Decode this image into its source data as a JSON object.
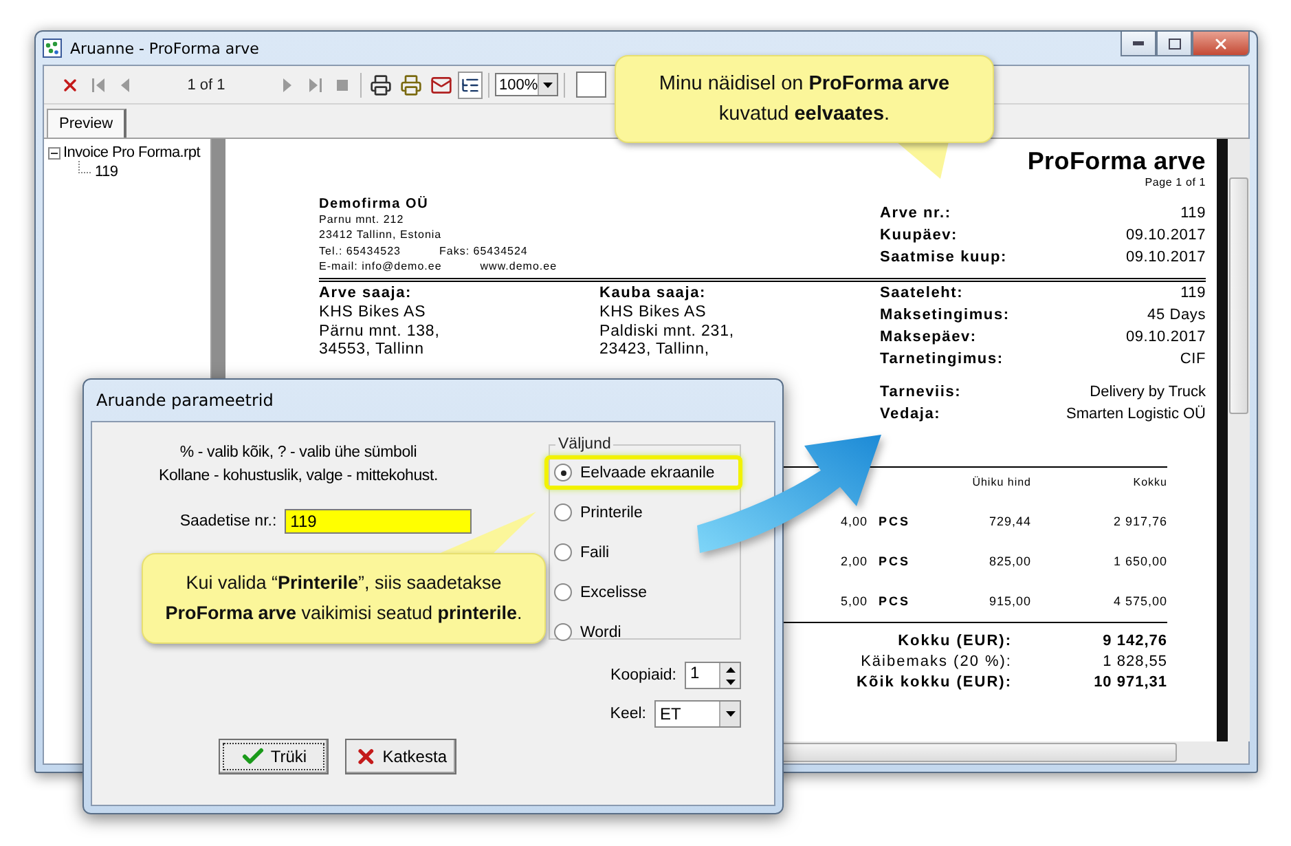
{
  "window": {
    "title": "Aruanne - ProForma arve",
    "page_indicator": "1 of 1",
    "zoom": "100%"
  },
  "tabs": [
    {
      "label": "Preview",
      "selected": true
    }
  ],
  "tree": [
    {
      "label": "Invoice Pro Forma.rpt",
      "expanded": true,
      "children": [
        {
          "label": "119"
        }
      ]
    }
  ],
  "invoice": {
    "title": "ProForma arve",
    "page": "Page 1 of 1",
    "company": {
      "name": "Demofirma OÜ",
      "lines": [
        "Parnu mnt. 212",
        "23412 Tallinn, Estonia"
      ],
      "phone": "Tel.: 65434523",
      "fax": "Faks: 65434524",
      "email": "E-mail: info@demo.ee",
      "web": "www.demo.ee"
    },
    "details": [
      {
        "label": "Arve nr.:",
        "value": "119"
      },
      {
        "label": "Kuupäev:",
        "value": "09.10.2017"
      },
      {
        "label": "Saatmise kuup:",
        "value": "09.10.2017"
      }
    ],
    "parties": [
      {
        "heading": "Arve saaja:",
        "lines": [
          "KHS Bikes AS",
          "Pärnu mnt. 138,",
          "34553, Tallinn"
        ]
      },
      {
        "heading": "Kauba saaja:",
        "lines": [
          "KHS Bikes AS",
          "Paldiski mnt. 231,",
          "23423, Tallinn,"
        ]
      }
    ],
    "terms": [
      {
        "label": "Saateleht:",
        "value": "119"
      },
      {
        "label": "Maksetingimus:",
        "value": "45 Days"
      },
      {
        "label": "Maksepäev:",
        "value": "09.10.2017"
      },
      {
        "label": "Tarnetingimus:",
        "value": "CIF"
      }
    ],
    "shipping": [
      {
        "label": "Tarneviis:",
        "value": "Delivery by Truck"
      },
      {
        "label": "Vedaja:",
        "value": "Smarten Logistic OÜ"
      }
    ],
    "columns": [
      "Ühiku hind",
      "Kokku"
    ],
    "rows": [
      {
        "quantity": "4,00",
        "unit": "PCS",
        "price": "729,44",
        "total": "2 917,76"
      },
      {
        "quantity": "2,00",
        "unit": "PCS",
        "price": "825,00",
        "total": "1 650,00"
      },
      {
        "quantity": "5,00",
        "unit": "PCS",
        "price": "915,00",
        "total": "4 575,00"
      }
    ],
    "totals": [
      {
        "label": "Kokku (EUR):",
        "value": "9 142,76",
        "bold": true
      },
      {
        "label": "Käibemaks (20 %):",
        "value": "1 828,55",
        "bold": false
      },
      {
        "label": "Kõik kokku (EUR):",
        "value": "10 971,31",
        "bold": true
      }
    ]
  },
  "dialog": {
    "title": "Aruande parameetrid",
    "hints": [
      "% - valib kõik, ? - valib ühe sümboli",
      "Kollane - kohustuslik, valge - mittekohust."
    ],
    "field_label": "Saadetise nr.:",
    "field_value": "119",
    "group_title": "Väljund",
    "outputs": [
      {
        "label": "Eelvaade ekraanile",
        "selected": true
      },
      {
        "label": "Printerile",
        "selected": false
      },
      {
        "label": "Faili",
        "selected": false
      },
      {
        "label": "Excelisse",
        "selected": false
      },
      {
        "label": "Wordi",
        "selected": false
      }
    ],
    "copies_label": "Koopiaid:",
    "copies": "1",
    "language_label": "Keel:",
    "language": "ET",
    "buttons": [
      {
        "label": "Trüki",
        "kind": "ok"
      },
      {
        "label": "Katkesta",
        "kind": "cancel"
      }
    ]
  },
  "callouts": [
    {
      "text": "Minu näidisel on **ProForma arve** kuvatud **eelvaates**."
    },
    {
      "text": "Kui valida “**Printerile**”, siis saadetakse **ProForma arve** vaikimisi seatud **printerile**."
    }
  ]
}
